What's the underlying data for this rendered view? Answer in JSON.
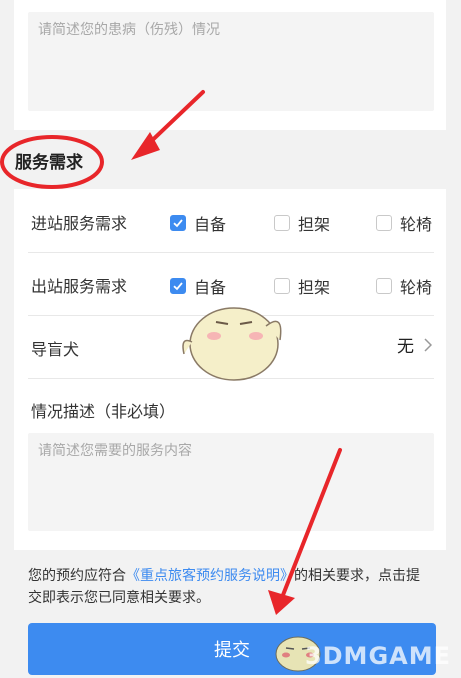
{
  "illness": {
    "placeholder": "请简述您的患病（伤残）情况"
  },
  "section_title": "服务需求",
  "rows": {
    "inbound": {
      "label": "进站服务需求",
      "options": [
        "自备",
        "担架",
        "轮椅"
      ],
      "checked": "自备"
    },
    "outbound": {
      "label": "出站服务需求",
      "options": [
        "自备",
        "担架",
        "轮椅"
      ],
      "checked": "自备"
    },
    "guide_dog": {
      "label": "导盲犬",
      "value": "无"
    }
  },
  "situation": {
    "label": "情况描述（非必填）",
    "placeholder": "请简述您需要的服务内容"
  },
  "notice": {
    "before": "您的预约应符合",
    "link": "《重点旅客预约服务说明》",
    "after": "的相关要求，点击提交即表示您已同意相关要求。"
  },
  "submit_label": "提交",
  "watermark": "3DMGAME",
  "colors": {
    "accent": "#3d8bf0",
    "annotation": "#e8262a"
  }
}
